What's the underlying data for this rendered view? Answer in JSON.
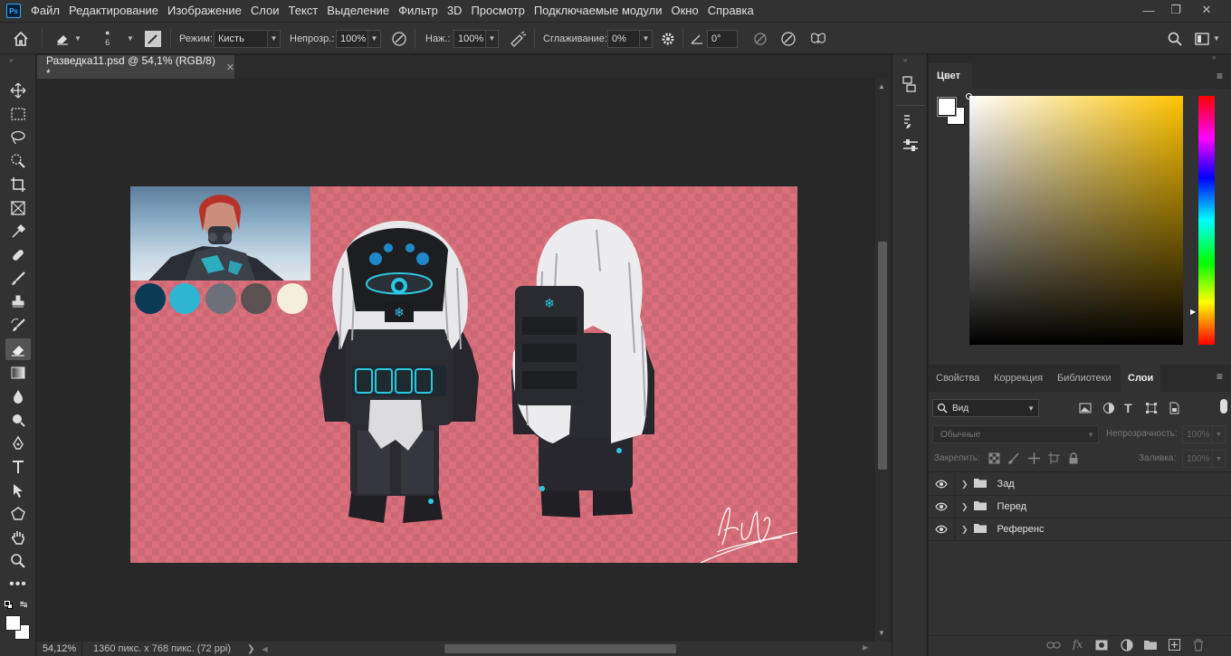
{
  "app": {
    "logo_text": "Ps"
  },
  "menu": [
    "Файл",
    "Редактирование",
    "Изображение",
    "Слои",
    "Текст",
    "Выделение",
    "Фильтр",
    "3D",
    "Просмотр",
    "Подключаемые модули",
    "Окно",
    "Справка"
  ],
  "options": {
    "brush_size": "6",
    "mode_label": "Режим:",
    "mode_value": "Кисть",
    "opacity_label": "Непрозр.:",
    "opacity_value": "100%",
    "pressure_label": "Наж.:",
    "pressure_value": "100%",
    "smoothing_label": "Сглаживание:",
    "smoothing_value": "0%",
    "angle_value": "0°"
  },
  "document": {
    "tab_title": "Разведка11.psd @ 54,1% (RGB/8) *",
    "canvas_bg": "#d9707c",
    "swatches": [
      "#0b3a55",
      "#2db5d2",
      "#6e7078",
      "#5a5252",
      "#f5eed9"
    ]
  },
  "status": {
    "zoom": "54,12%",
    "info": "1360 пикс. x 768 пикс. (72 ppi)"
  },
  "color_panel": {
    "title": "Цвет",
    "hue_color": "#ffc400"
  },
  "layers_panel": {
    "tabs": [
      "Свойства",
      "Коррекция",
      "Библиотеки",
      "Слои"
    ],
    "active_tab": "Слои",
    "filter_label": "Вид",
    "blend_mode": "Обычные",
    "opacity_label": "Непрозрачность:",
    "opacity_value": "100%",
    "lock_label": "Закрепить:",
    "fill_label": "Заливка:",
    "fill_value": "100%",
    "layers": [
      {
        "name": "Зад"
      },
      {
        "name": "Перед"
      },
      {
        "name": "Референс"
      }
    ]
  }
}
